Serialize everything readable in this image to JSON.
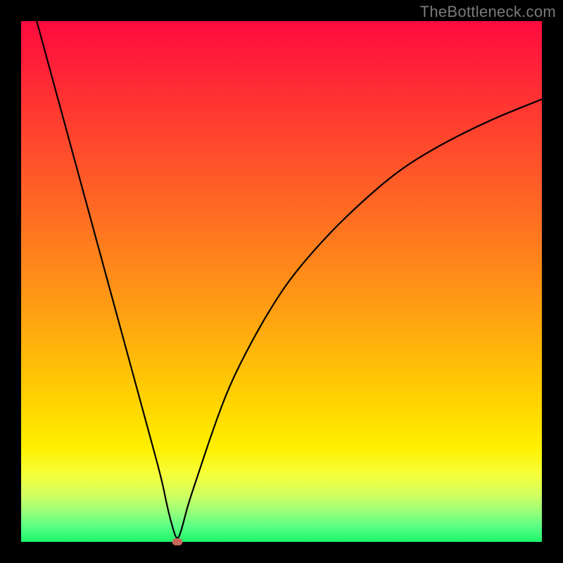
{
  "watermark": "TheBottleneck.com",
  "chart_data": {
    "type": "line",
    "title": "",
    "xlabel": "",
    "ylabel": "",
    "xlim": [
      0,
      100
    ],
    "ylim": [
      0,
      100
    ],
    "grid": false,
    "legend": false,
    "curve": {
      "name": "bottleneck-curve",
      "x": [
        3,
        6,
        9,
        12,
        15,
        18,
        21,
        24,
        27,
        28,
        29,
        30,
        31,
        32,
        34,
        37,
        40,
        44,
        48,
        52,
        58,
        64,
        72,
        80,
        90,
        100
      ],
      "y": [
        100,
        89,
        78,
        67,
        56,
        45,
        34,
        23,
        12,
        7,
        3,
        0,
        3,
        7,
        13,
        22,
        30,
        38,
        45,
        51,
        58,
        64,
        71,
        76,
        81,
        85
      ]
    },
    "marker": {
      "x": 30,
      "y": 0
    },
    "gradient_stops": [
      {
        "pos": 0,
        "color": "#ff0b3e"
      },
      {
        "pos": 50,
        "color": "#ff9a14"
      },
      {
        "pos": 80,
        "color": "#fff000"
      },
      {
        "pos": 100,
        "color": "#1cf56a"
      }
    ]
  }
}
